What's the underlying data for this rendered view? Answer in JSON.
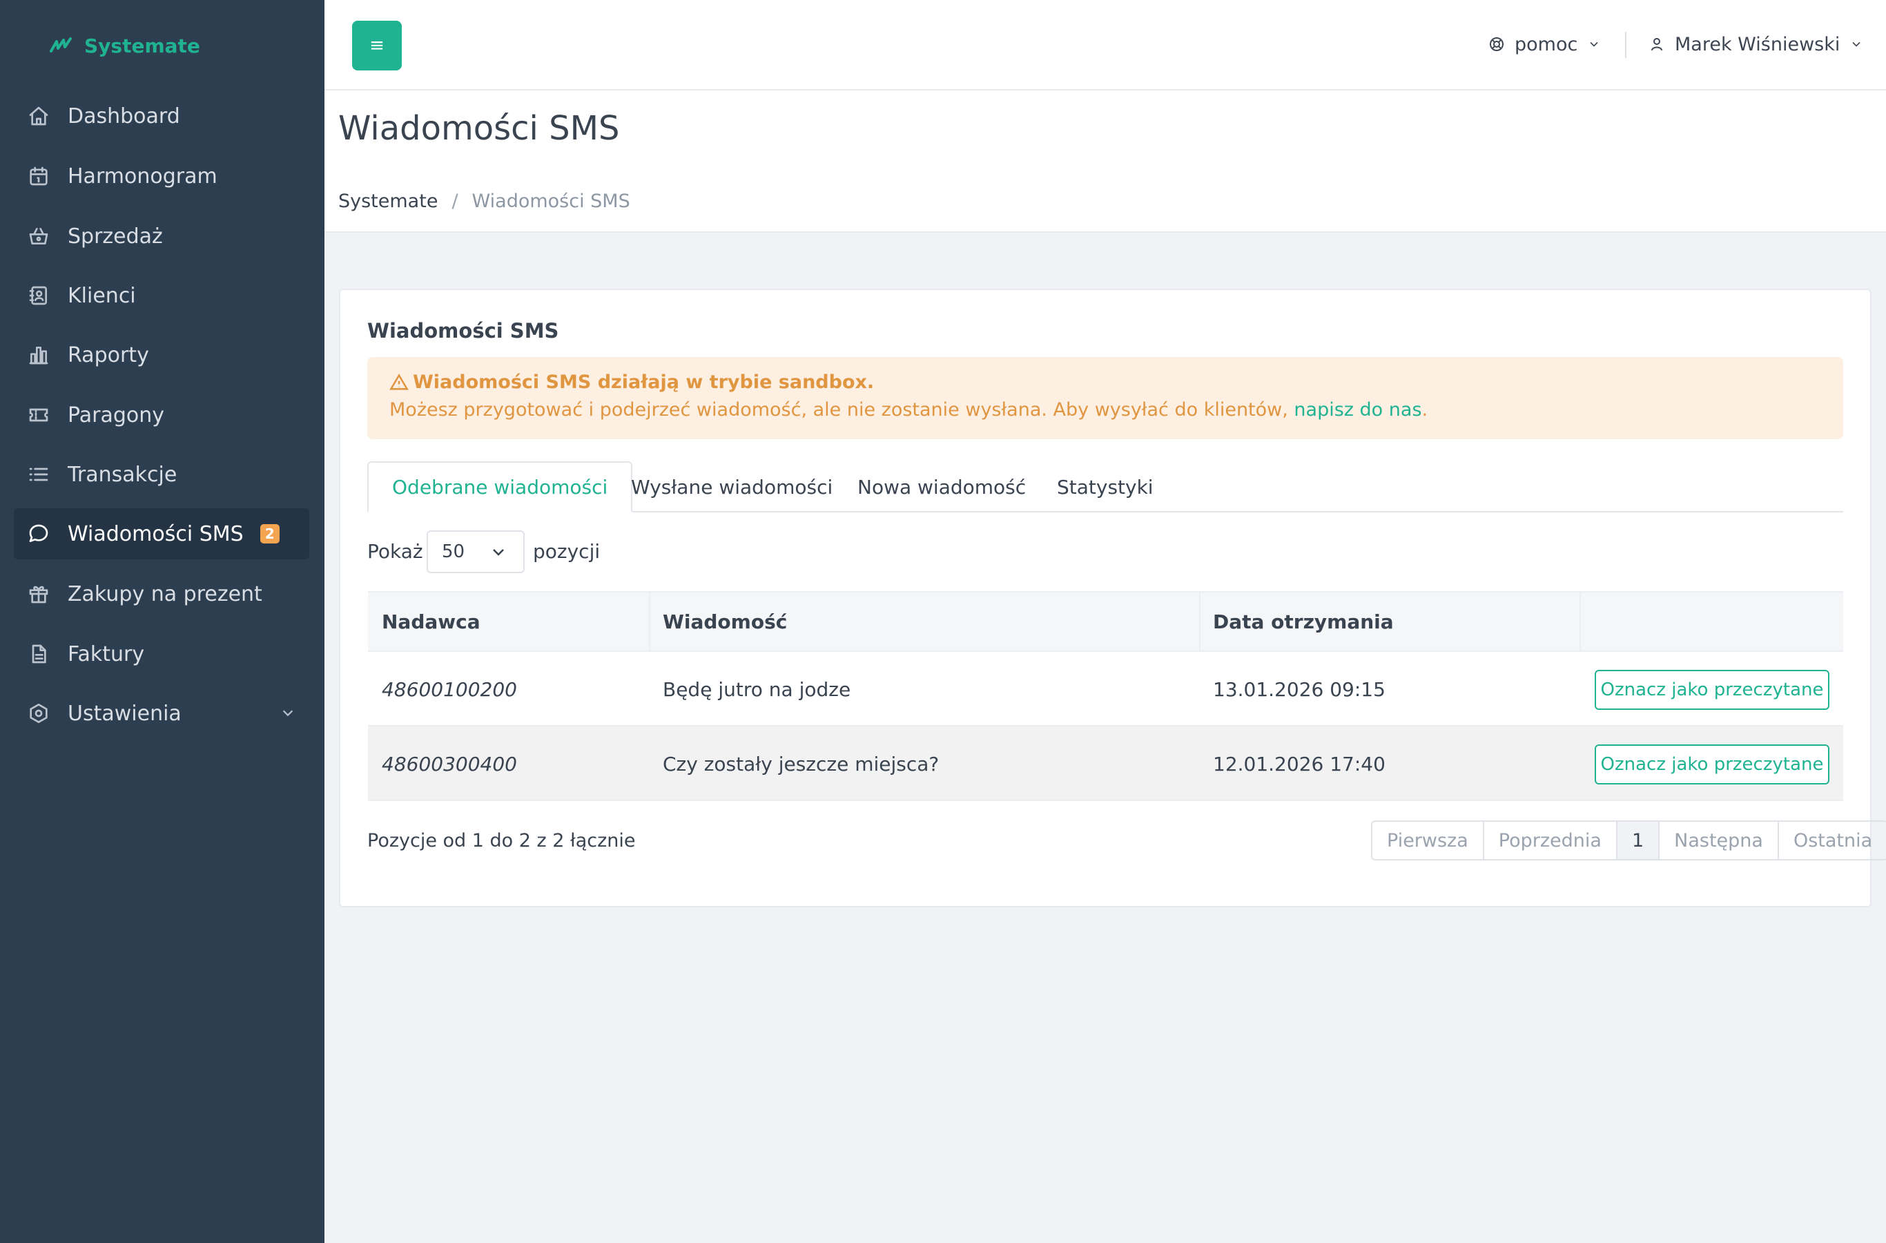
{
  "brand": {
    "name": "Systemate"
  },
  "sidebar": {
    "items": [
      {
        "label": "Dashboard",
        "icon": "home-icon"
      },
      {
        "label": "Harmonogram",
        "icon": "calendar-icon"
      },
      {
        "label": "Sprzedaż",
        "icon": "basket-icon"
      },
      {
        "label": "Klienci",
        "icon": "contacts-icon"
      },
      {
        "label": "Raporty",
        "icon": "bar-chart-icon"
      },
      {
        "label": "Paragony",
        "icon": "ticket-icon"
      },
      {
        "label": "Transakcje",
        "icon": "list-icon"
      },
      {
        "label": "Wiadomości SMS",
        "icon": "message-icon",
        "active": true,
        "badge": "2"
      },
      {
        "label": "Zakupy na prezent",
        "icon": "gift-icon"
      },
      {
        "label": "Faktury",
        "icon": "document-icon"
      },
      {
        "label": "Ustawienia",
        "icon": "settings-icon",
        "expandable": true
      }
    ]
  },
  "topbar": {
    "menu_label": "≡",
    "help_label": "pomoc",
    "user_name": "Marek Wiśniewski"
  },
  "page": {
    "title": "Wiadomości SMS",
    "breadcrumb": {
      "root": "Systemate",
      "separator": "/",
      "current": "Wiadomości SMS"
    }
  },
  "card": {
    "title": "Wiadomości SMS",
    "alert": {
      "title": "Wiadomości SMS działają w trybie sandbox.",
      "body": "Możesz przygotować i podejrzeć wiadomość, ale nie zostanie wysłana. Aby wysyłać do klientów, ",
      "link": "napisz do nas",
      "end": "."
    },
    "tabs": [
      "Odebrane wiadomości",
      "Wysłane wiadomości",
      "Nowa wiadomość",
      "Statystyki"
    ],
    "show": {
      "label": "Pokaż",
      "value": "50",
      "suffix": "pozycji"
    },
    "table": {
      "columns": [
        "Nadawca",
        "Wiadomość",
        "Data otrzymania",
        ""
      ],
      "rows": [
        {
          "sender": "48600100200",
          "message": "Będę jutro na jodze",
          "date": "13.01.2026 09:15",
          "action": "Oznacz jako przeczytane"
        },
        {
          "sender": "48600300400",
          "message": "Czy zostały jeszcze miejsca?",
          "date": "12.01.2026 17:40",
          "action": "Oznacz jako przeczytane"
        }
      ]
    },
    "info": "Pozycje od 1 do 2 z 2 łącznie",
    "pagination": [
      "Pierwsza",
      "Poprzednia",
      "1",
      "Następna",
      "Ostatnia"
    ]
  },
  "colors": {
    "accent": "#1fb392",
    "sidebar": "#2d3e50",
    "warning": "#e09540",
    "badge": "#f5a451"
  }
}
